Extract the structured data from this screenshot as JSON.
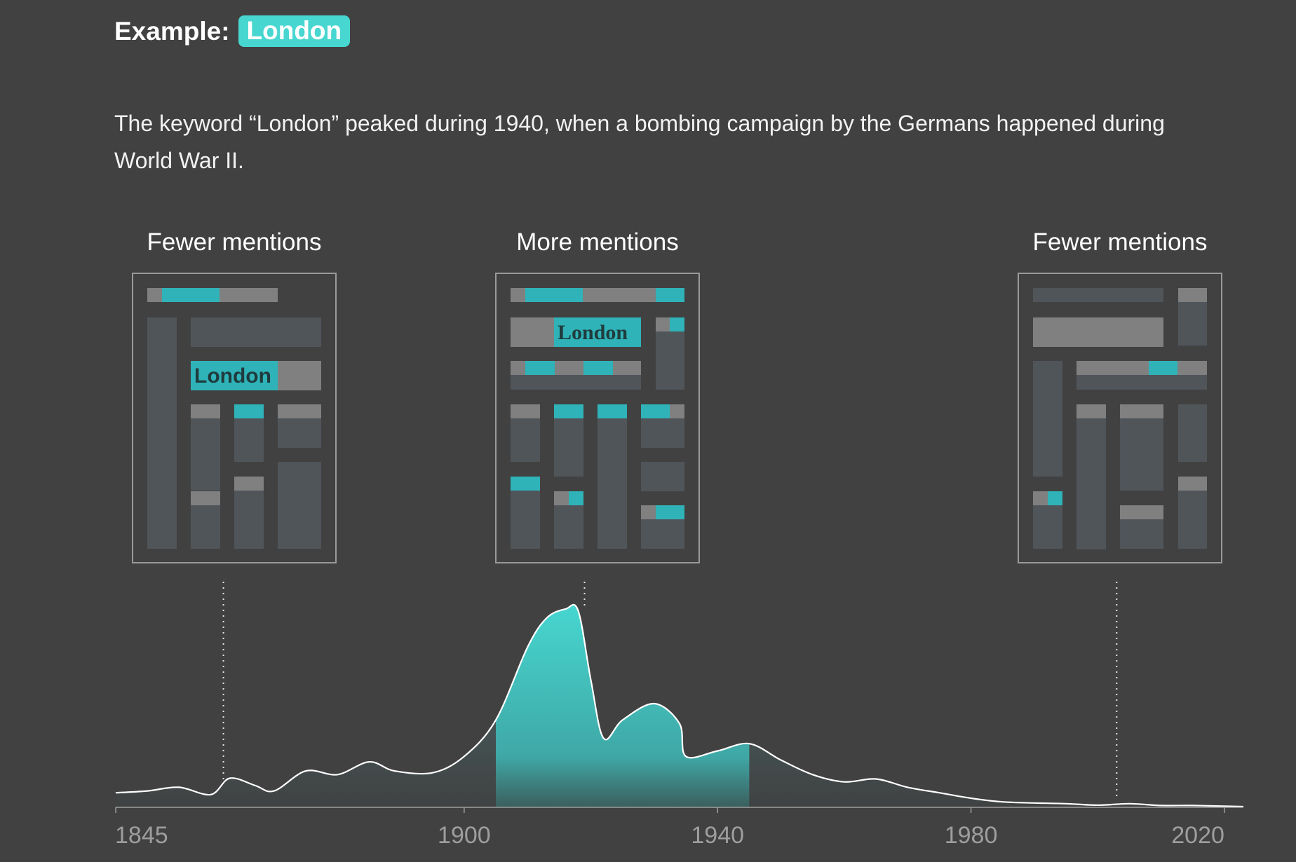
{
  "heading": {
    "prefix": "Example:",
    "keyword": "London"
  },
  "description": "The keyword “London” peaked during 1940, when a bombing campaign by the Germans happened during World War II.",
  "colors": {
    "background": "#414141",
    "accent": "#47d6d0",
    "accent_bar": "#2fb3b8",
    "block_dark": "#50555a",
    "block_light": "#808080",
    "frame": "#9a9a9a",
    "axis": "#9e9e9e"
  },
  "panels": [
    {
      "label": "Fewer mentions",
      "headline": "London",
      "headline_style": "sans",
      "year": 1862
    },
    {
      "label": "More mentions",
      "headline": "London",
      "headline_style": "serif",
      "year": 1919
    },
    {
      "label": "Fewer mentions",
      "headline": "",
      "headline_style": "none",
      "year": 2003
    }
  ],
  "chart_data": {
    "type": "area",
    "title": "",
    "xlabel": "",
    "ylabel": "",
    "xlim": [
      1845,
      2023
    ],
    "x_ticks": [
      "1845",
      "1900",
      "1940",
      "1980",
      "2020"
    ],
    "highlight_range": [
      1905,
      1945
    ],
    "series": [
      {
        "x": [
          1845,
          1850,
          1855,
          1860,
          1863,
          1867,
          1870,
          1875,
          1880,
          1885,
          1889,
          1895,
          1900,
          1905,
          1910,
          1913,
          1916,
          1918,
          1920,
          1922,
          1925,
          1930,
          1934,
          1935,
          1940,
          1945,
          1950,
          1955,
          1960,
          1965,
          1970,
          1975,
          1980,
          1985,
          1990,
          1995,
          2000,
          2005,
          2010,
          2015,
          2020,
          2023
        ],
        "y": [
          4.0,
          4.5,
          5.5,
          3.5,
          8.0,
          6.0,
          4.5,
          10.0,
          9.0,
          12.5,
          10.0,
          9.5,
          14.0,
          24.0,
          44.0,
          52.0,
          54.5,
          54.0,
          35.0,
          19.0,
          24.0,
          28.5,
          23.0,
          14.0,
          15.5,
          17.5,
          13.0,
          9.0,
          7.0,
          7.8,
          5.5,
          4.0,
          2.5,
          1.5,
          1.2,
          1.0,
          0.6,
          1.0,
          0.5,
          0.5,
          0.3,
          0.2
        ]
      }
    ]
  }
}
